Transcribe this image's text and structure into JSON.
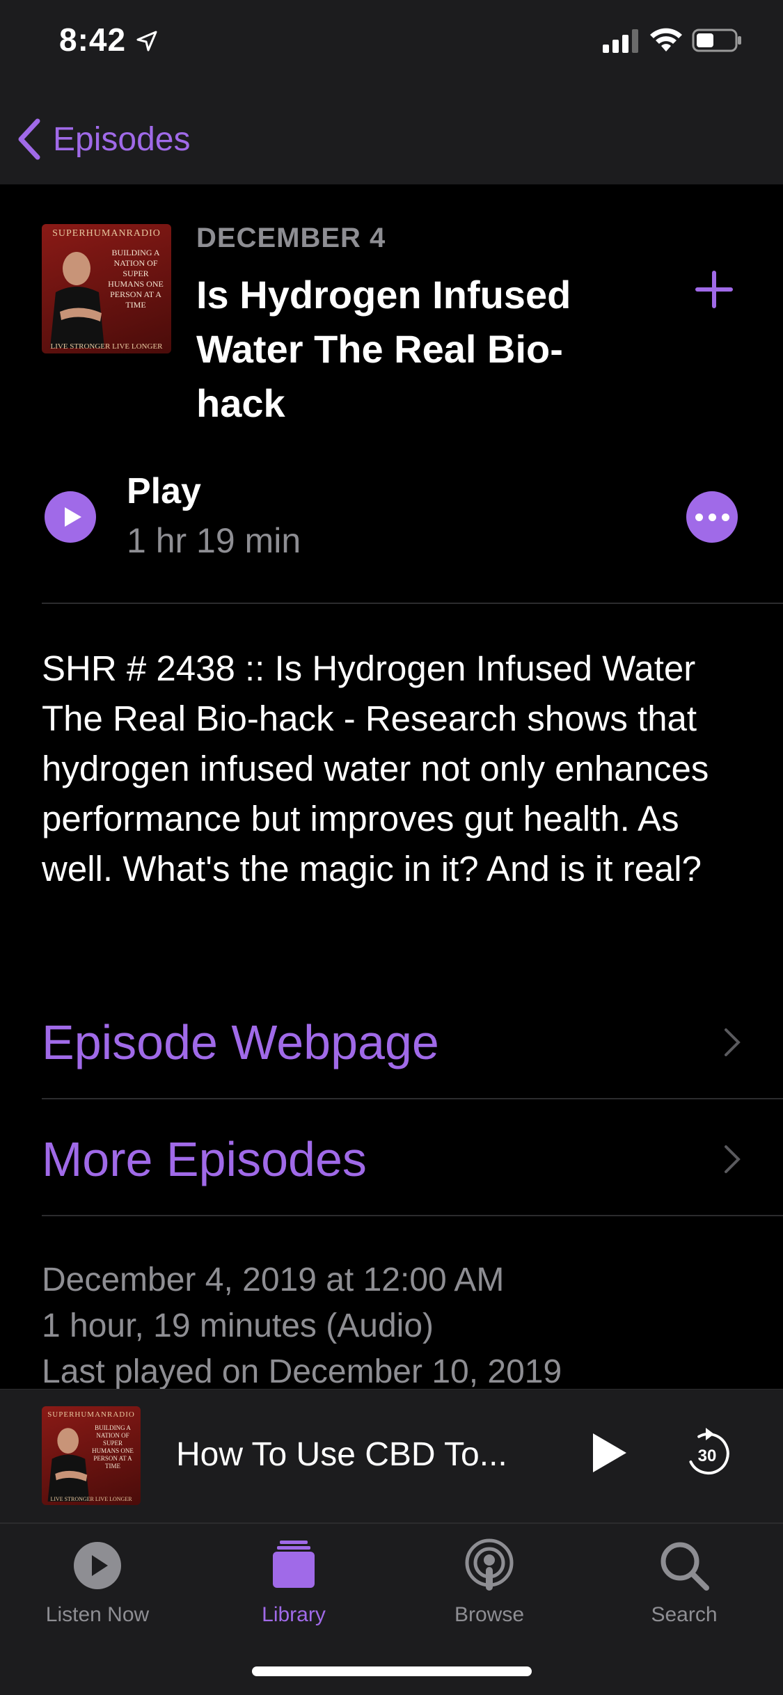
{
  "status": {
    "time": "8:42"
  },
  "nav": {
    "back_label": "Episodes"
  },
  "episode": {
    "artwork": {
      "brand": "SUPERHUMANRADIO",
      "tagline": "BUILDING A NATION OF SUPER HUMANS ONE PERSON AT A TIME",
      "footer": "LIVE STRONGER LIVE LONGER"
    },
    "date": "DECEMBER 4",
    "title": "Is Hydrogen Infused Water The Real Bio-hack",
    "play_label": "Play",
    "duration": "1 hr 19 min",
    "description": "SHR # 2438 :: Is Hydrogen Infused Water The Real Bio-hack - Research shows that hydrogen infused water not only enhances performance but improves gut health. As well. What's the magic in it? And is it real?"
  },
  "links": [
    {
      "label": "Episode Webpage"
    },
    {
      "label": "More Episodes"
    }
  ],
  "meta": {
    "published": "December 4, 2019 at 12:00 AM",
    "length": "1 hour, 19 minutes (Audio)",
    "last_played": "Last played on December 10, 2019"
  },
  "mini_player": {
    "title": "How To Use CBD To...",
    "skip_seconds": "30"
  },
  "tabs": [
    {
      "label": "Listen Now",
      "icon": "play-circle-icon",
      "active": false
    },
    {
      "label": "Library",
      "icon": "library-stack-icon",
      "active": true
    },
    {
      "label": "Browse",
      "icon": "podcast-icon",
      "active": false
    },
    {
      "label": "Search",
      "icon": "search-icon",
      "active": false
    }
  ],
  "colors": {
    "accent": "#a06ae8",
    "background": "#000000",
    "bar": "#1c1c1e",
    "secondary_text": "#8e8e93"
  }
}
